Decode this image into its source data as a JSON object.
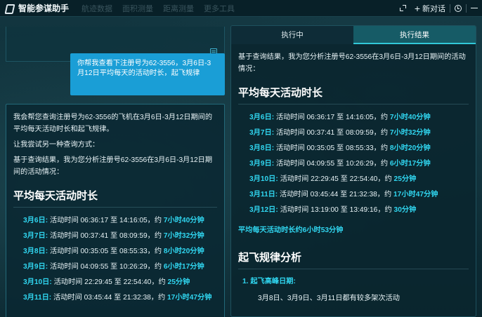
{
  "app": {
    "title": "智能参谋助手",
    "bg_tabs": [
      "航迹数据",
      "面积测量",
      "距离测量",
      "更多工具"
    ],
    "new_chat_label": "新对话"
  },
  "chat": {
    "user_message": "你帮我查看下注册号为62-3556，3月6日-3月12日平均每天的活动时长，起飞规律",
    "ai_intro_1": "我会帮您查询注册号为62-3556的飞机在3月6日-3月12日期间的平均每天活动时长和起飞规律。",
    "ai_intro_2": "让我尝试另一种查询方式：",
    "ai_intro_3": "基于查询结果，我为您分析注册号62-3556在3月6日-3月12日期间的活动情况：",
    "heading": "平均每天活动时长",
    "rows": [
      {
        "date": "3月6日:",
        "text": " 活动时间 06:36:17 至 14:16:05，约 ",
        "dur": "7小时40分钟"
      },
      {
        "date": "3月7日:",
        "text": " 活动时间 00:37:41 至 08:09:59，约 ",
        "dur": "7小时32分钟"
      },
      {
        "date": "3月8日:",
        "text": " 活动时间 00:35:05 至 08:55:33，约 ",
        "dur": "8小时20分钟"
      },
      {
        "date": "3月9日:",
        "text": " 活动时间 04:09:55 至 10:26:29，约 ",
        "dur": "6小时17分钟"
      },
      {
        "date": "3月10日:",
        "text": " 活动时间 22:29:45 至 22:54:40，约 ",
        "dur": "25分钟"
      },
      {
        "date": "3月11日:",
        "text": " 活动时间 03:45:44 至 21:32:38，约 ",
        "dur": "17小时47分钟"
      }
    ]
  },
  "result": {
    "tabs": {
      "running": "执行中",
      "result": "执行结果"
    },
    "intro": "基于查询结果，我为您分析注册号62-3556在3月6日-3月12日期间的活动情况：",
    "heading": "平均每天活动时长",
    "rows": [
      {
        "date": "3月6日:",
        "text": " 活动时间 06:36:17 至 14:16:05，约 ",
        "dur": "7小时40分钟"
      },
      {
        "date": "3月7日:",
        "text": " 活动时间 00:37:41 至 08:09:59，约 ",
        "dur": "7小时32分钟"
      },
      {
        "date": "3月8日:",
        "text": " 活动时间 00:35:05 至 08:55:33，约 ",
        "dur": "8小时20分钟"
      },
      {
        "date": "3月9日:",
        "text": " 活动时间 04:09:55 至 10:26:29，约 ",
        "dur": "6小时17分钟"
      },
      {
        "date": "3月10日:",
        "text": " 活动时间 22:29:45 至 22:54:40，约 ",
        "dur": "25分钟"
      },
      {
        "date": "3月11日:",
        "text": " 活动时间 03:45:44 至 21:32:38，约 ",
        "dur": "17小时47分钟"
      },
      {
        "date": "3月12日:",
        "text": " 活动时间 13:19:00 至 13:49:16，约 ",
        "dur": "30分钟"
      }
    ],
    "summary": "平均每天活动时长约6小时53分钟",
    "heading2": "起飞规律分析",
    "list_item_1": "1. 起飞高峰日期:",
    "list_item_1_text": "3月8日、3月9日、3月11日都有较多架次活动"
  }
}
